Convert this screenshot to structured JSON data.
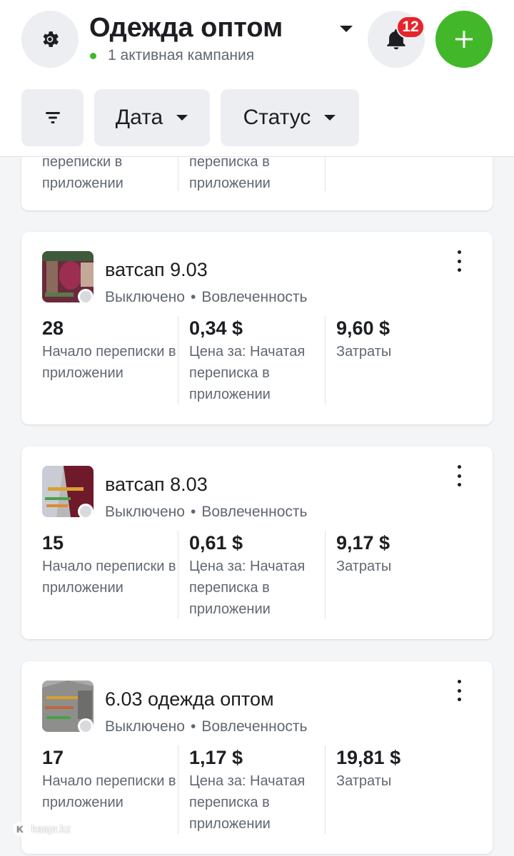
{
  "header": {
    "account_title": "Одежда оптом",
    "active_campaigns": "1 активная кампания",
    "notifications_count": "12",
    "colors": {
      "accent_green": "#42b72a",
      "badge_red": "#e4252b"
    }
  },
  "filters": {
    "date_label": "Дата",
    "status_label": "Статус"
  },
  "partial_card": {
    "metrics": [
      {
        "label": "переписки в приложении"
      },
      {
        "label": "переписка в приложении"
      },
      {
        "label": ""
      }
    ]
  },
  "ads": [
    {
      "name": "ватсап 9.03",
      "status": "Выключено",
      "objective": "Вовлеченность",
      "metrics": [
        {
          "value": "28",
          "label": "Начало переписки в приложении"
        },
        {
          "value": "0,34 $",
          "label": "Цена за: Начатая переписка в приложении"
        },
        {
          "value": "9,60 $",
          "label": "Затраты"
        }
      ]
    },
    {
      "name": "ватсап 8.03",
      "status": "Выключено",
      "objective": "Вовлеченность",
      "metrics": [
        {
          "value": "15",
          "label": "Начало переписки в приложении"
        },
        {
          "value": "0,61 $",
          "label": "Цена за: Начатая переписка в приложении"
        },
        {
          "value": "9,17 $",
          "label": "Затраты"
        }
      ]
    },
    {
      "name": "6.03 одежда оптом",
      "status": "Выключено",
      "objective": "Вовлеченность",
      "metrics": [
        {
          "value": "17",
          "label": "Начало переписки в приложении"
        },
        {
          "value": "1,17 $",
          "label": "Цена за: Начатая переписка в приложении"
        },
        {
          "value": "19,81 $",
          "label": "Затраты"
        }
      ]
    }
  ],
  "watermark": "kaspr.kz"
}
